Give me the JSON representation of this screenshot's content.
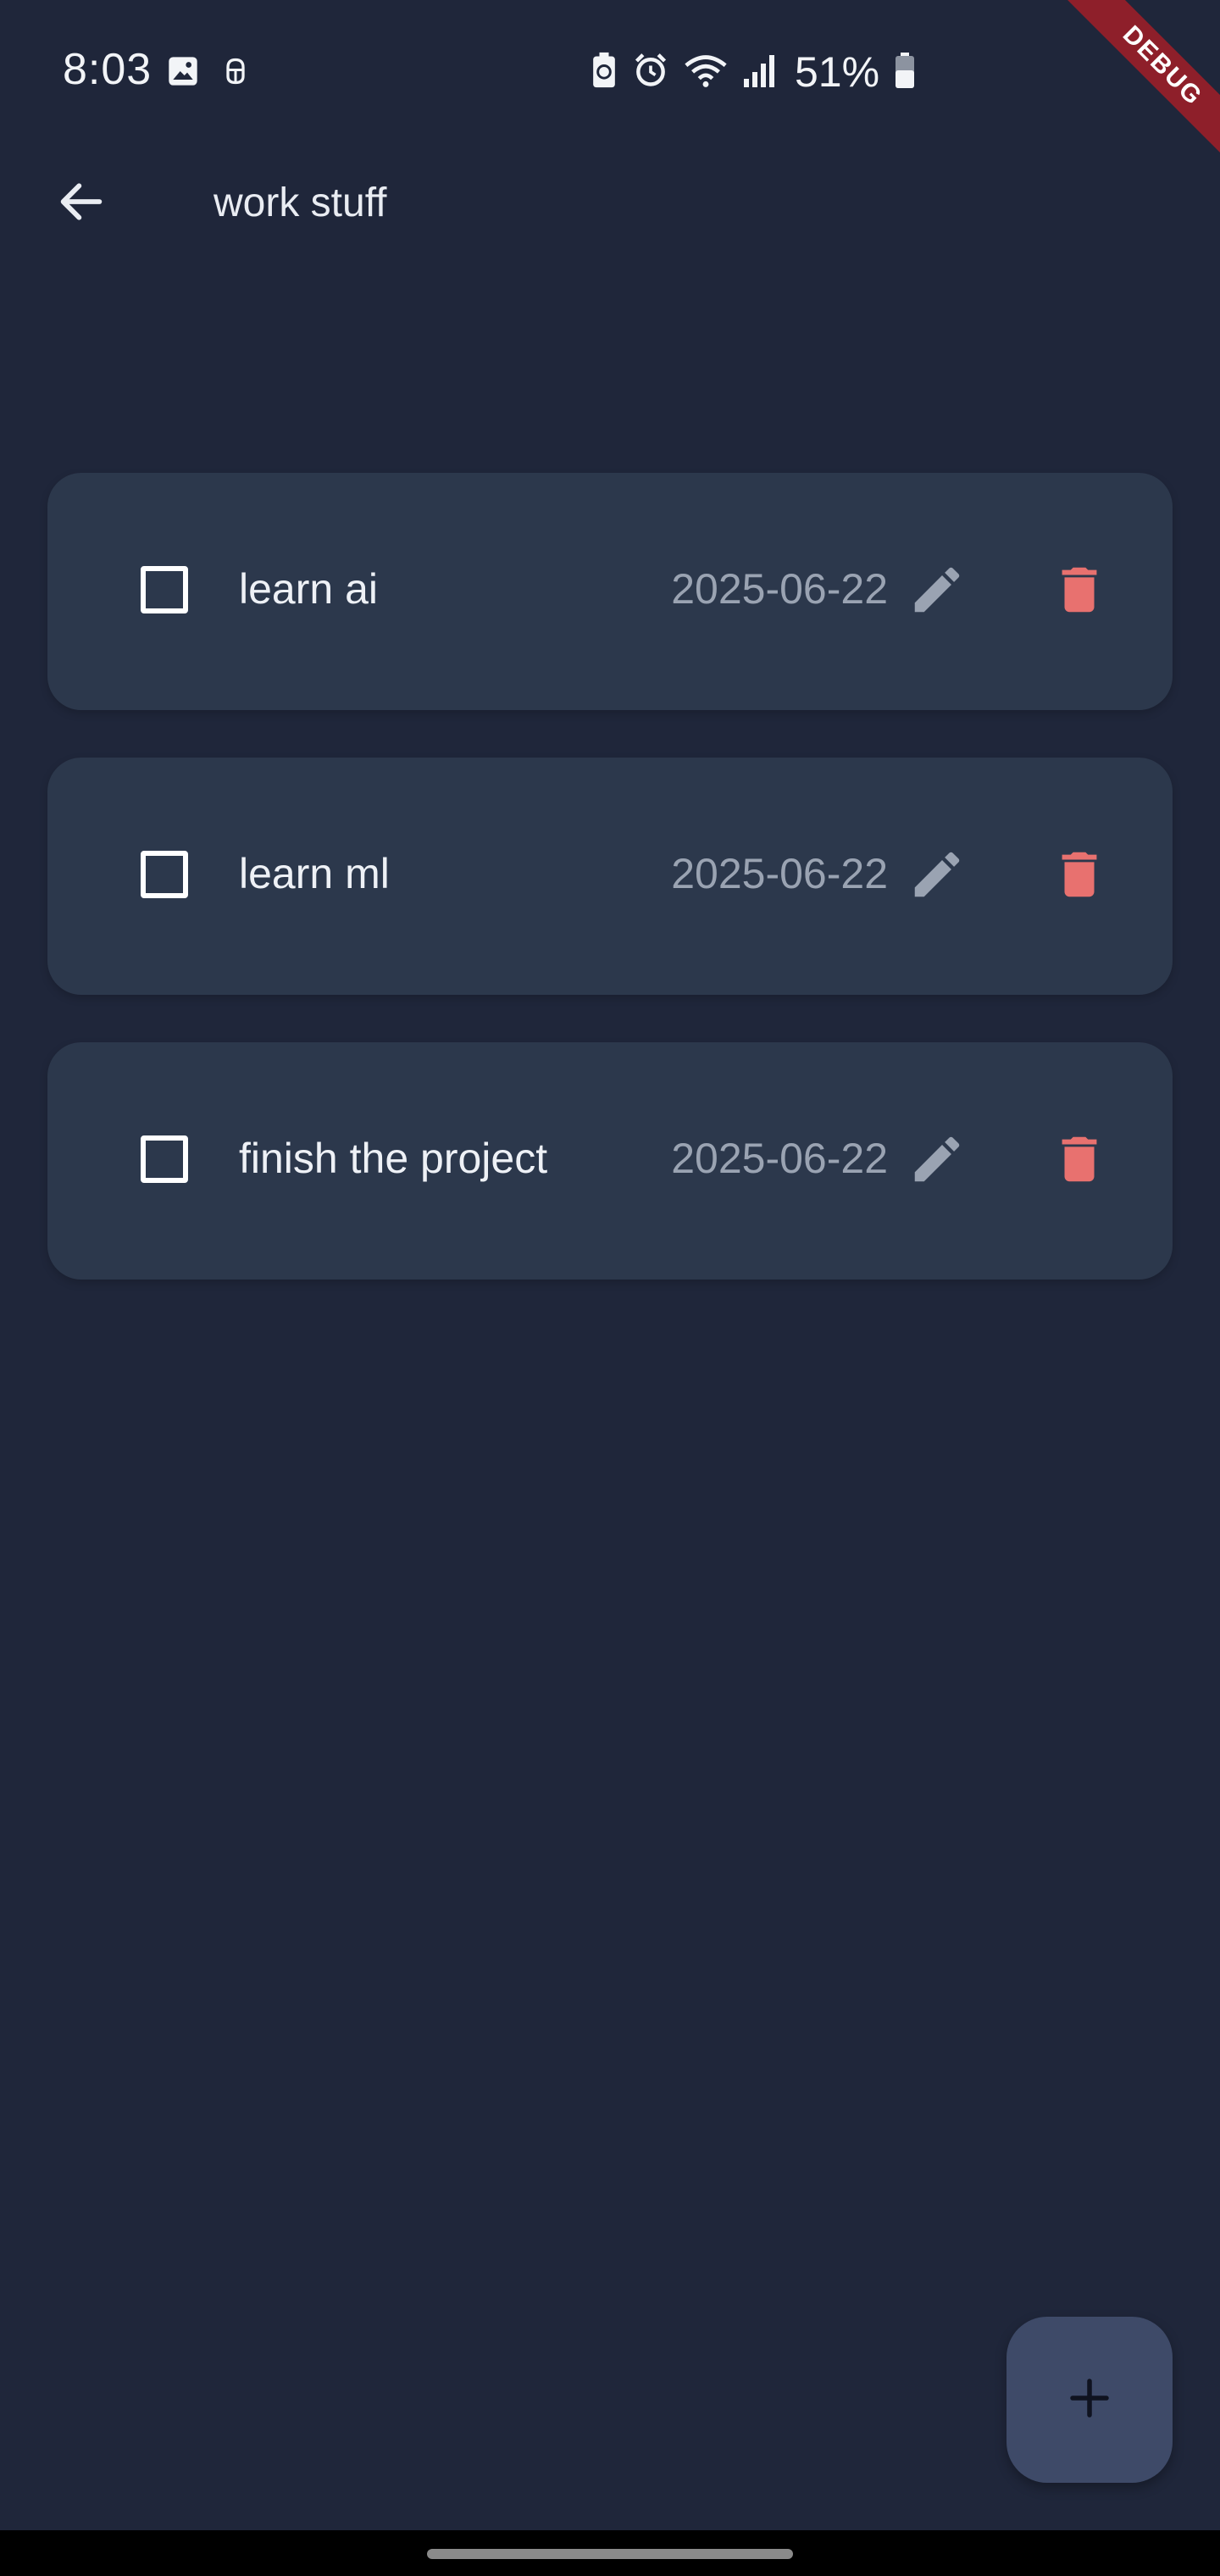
{
  "status_bar": {
    "time": "8:03",
    "battery_percent": "51%",
    "left_icons": [
      "image-icon",
      "android-debug-icon"
    ],
    "right_icons": [
      "battery-saver-icon",
      "alarm-icon",
      "wifi-icon",
      "signal-icon",
      "battery-icon"
    ]
  },
  "debug_banner": "DEBUG",
  "app_bar": {
    "title": "work stuff",
    "back_icon": "arrow-back-icon"
  },
  "tasks": [
    {
      "label": "learn ai",
      "date": "2025-06-22",
      "checked": false
    },
    {
      "label": "learn ml",
      "date": "2025-06-22",
      "checked": false
    },
    {
      "label": "finish the project",
      "date": "2025-06-22",
      "checked": false
    }
  ],
  "fab": {
    "icon": "add-icon"
  },
  "colors": {
    "background": "#1f263a",
    "card": "#2c384c",
    "delete": "#e8716f",
    "edit": "#9aa3b2",
    "fab": "#3e4a68",
    "debug": "#8e1f2a"
  }
}
